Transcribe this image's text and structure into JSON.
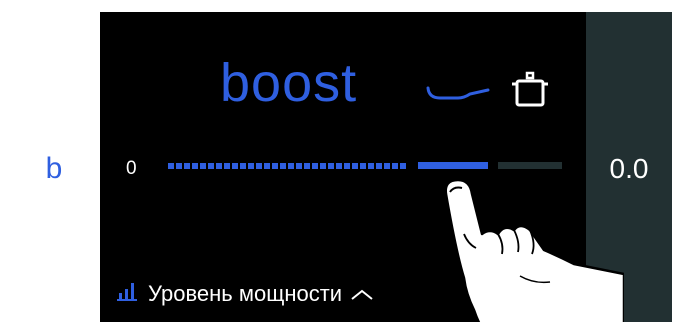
{
  "left_panel": {
    "label": "b"
  },
  "right_panel": {
    "value": "0.0"
  },
  "mode": {
    "title": "boost"
  },
  "scale": {
    "min_label": "0",
    "level_fraction": 0.78
  },
  "footer": {
    "label": "Уровень мощности",
    "icon": "signal-bars-icon",
    "chevron": "chevron-up-icon"
  },
  "icons": {
    "pan": "frying-pan-icon",
    "pot": "cooking-pot-icon",
    "hand": "pointing-hand-icon"
  },
  "colors": {
    "accent": "#2f5fe0",
    "screen_bg": "#000000",
    "inactive": "#223032",
    "text": "#ffffff"
  }
}
